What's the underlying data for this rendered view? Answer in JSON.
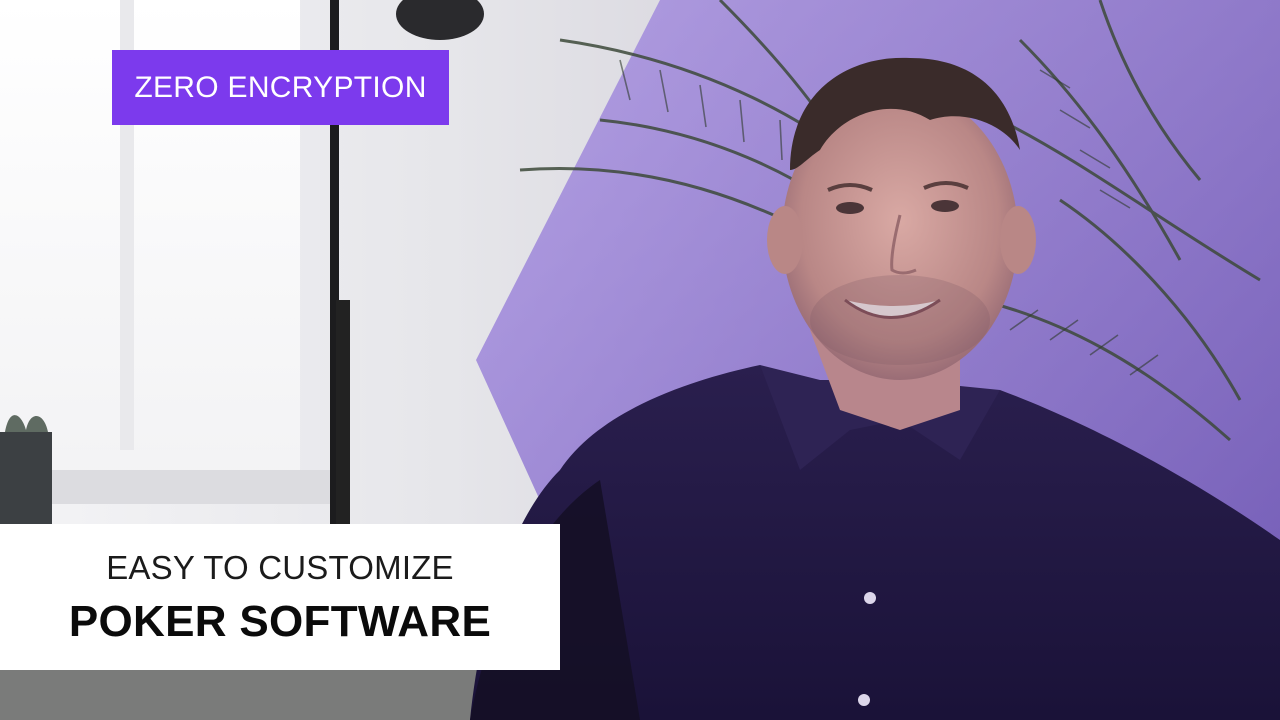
{
  "colors": {
    "accent": "#7c3aed",
    "overlay_purple": "#6b3fd1",
    "caption_bg": "#ffffff",
    "badge_text": "#ffffff"
  },
  "badge": {
    "text": "ZERO ENCRYPTION"
  },
  "caption": {
    "subtitle": "EASY TO CUSTOMIZE",
    "title": "POKER SOFTWARE"
  },
  "scene": {
    "description_icon": "video-still-person-icon"
  }
}
